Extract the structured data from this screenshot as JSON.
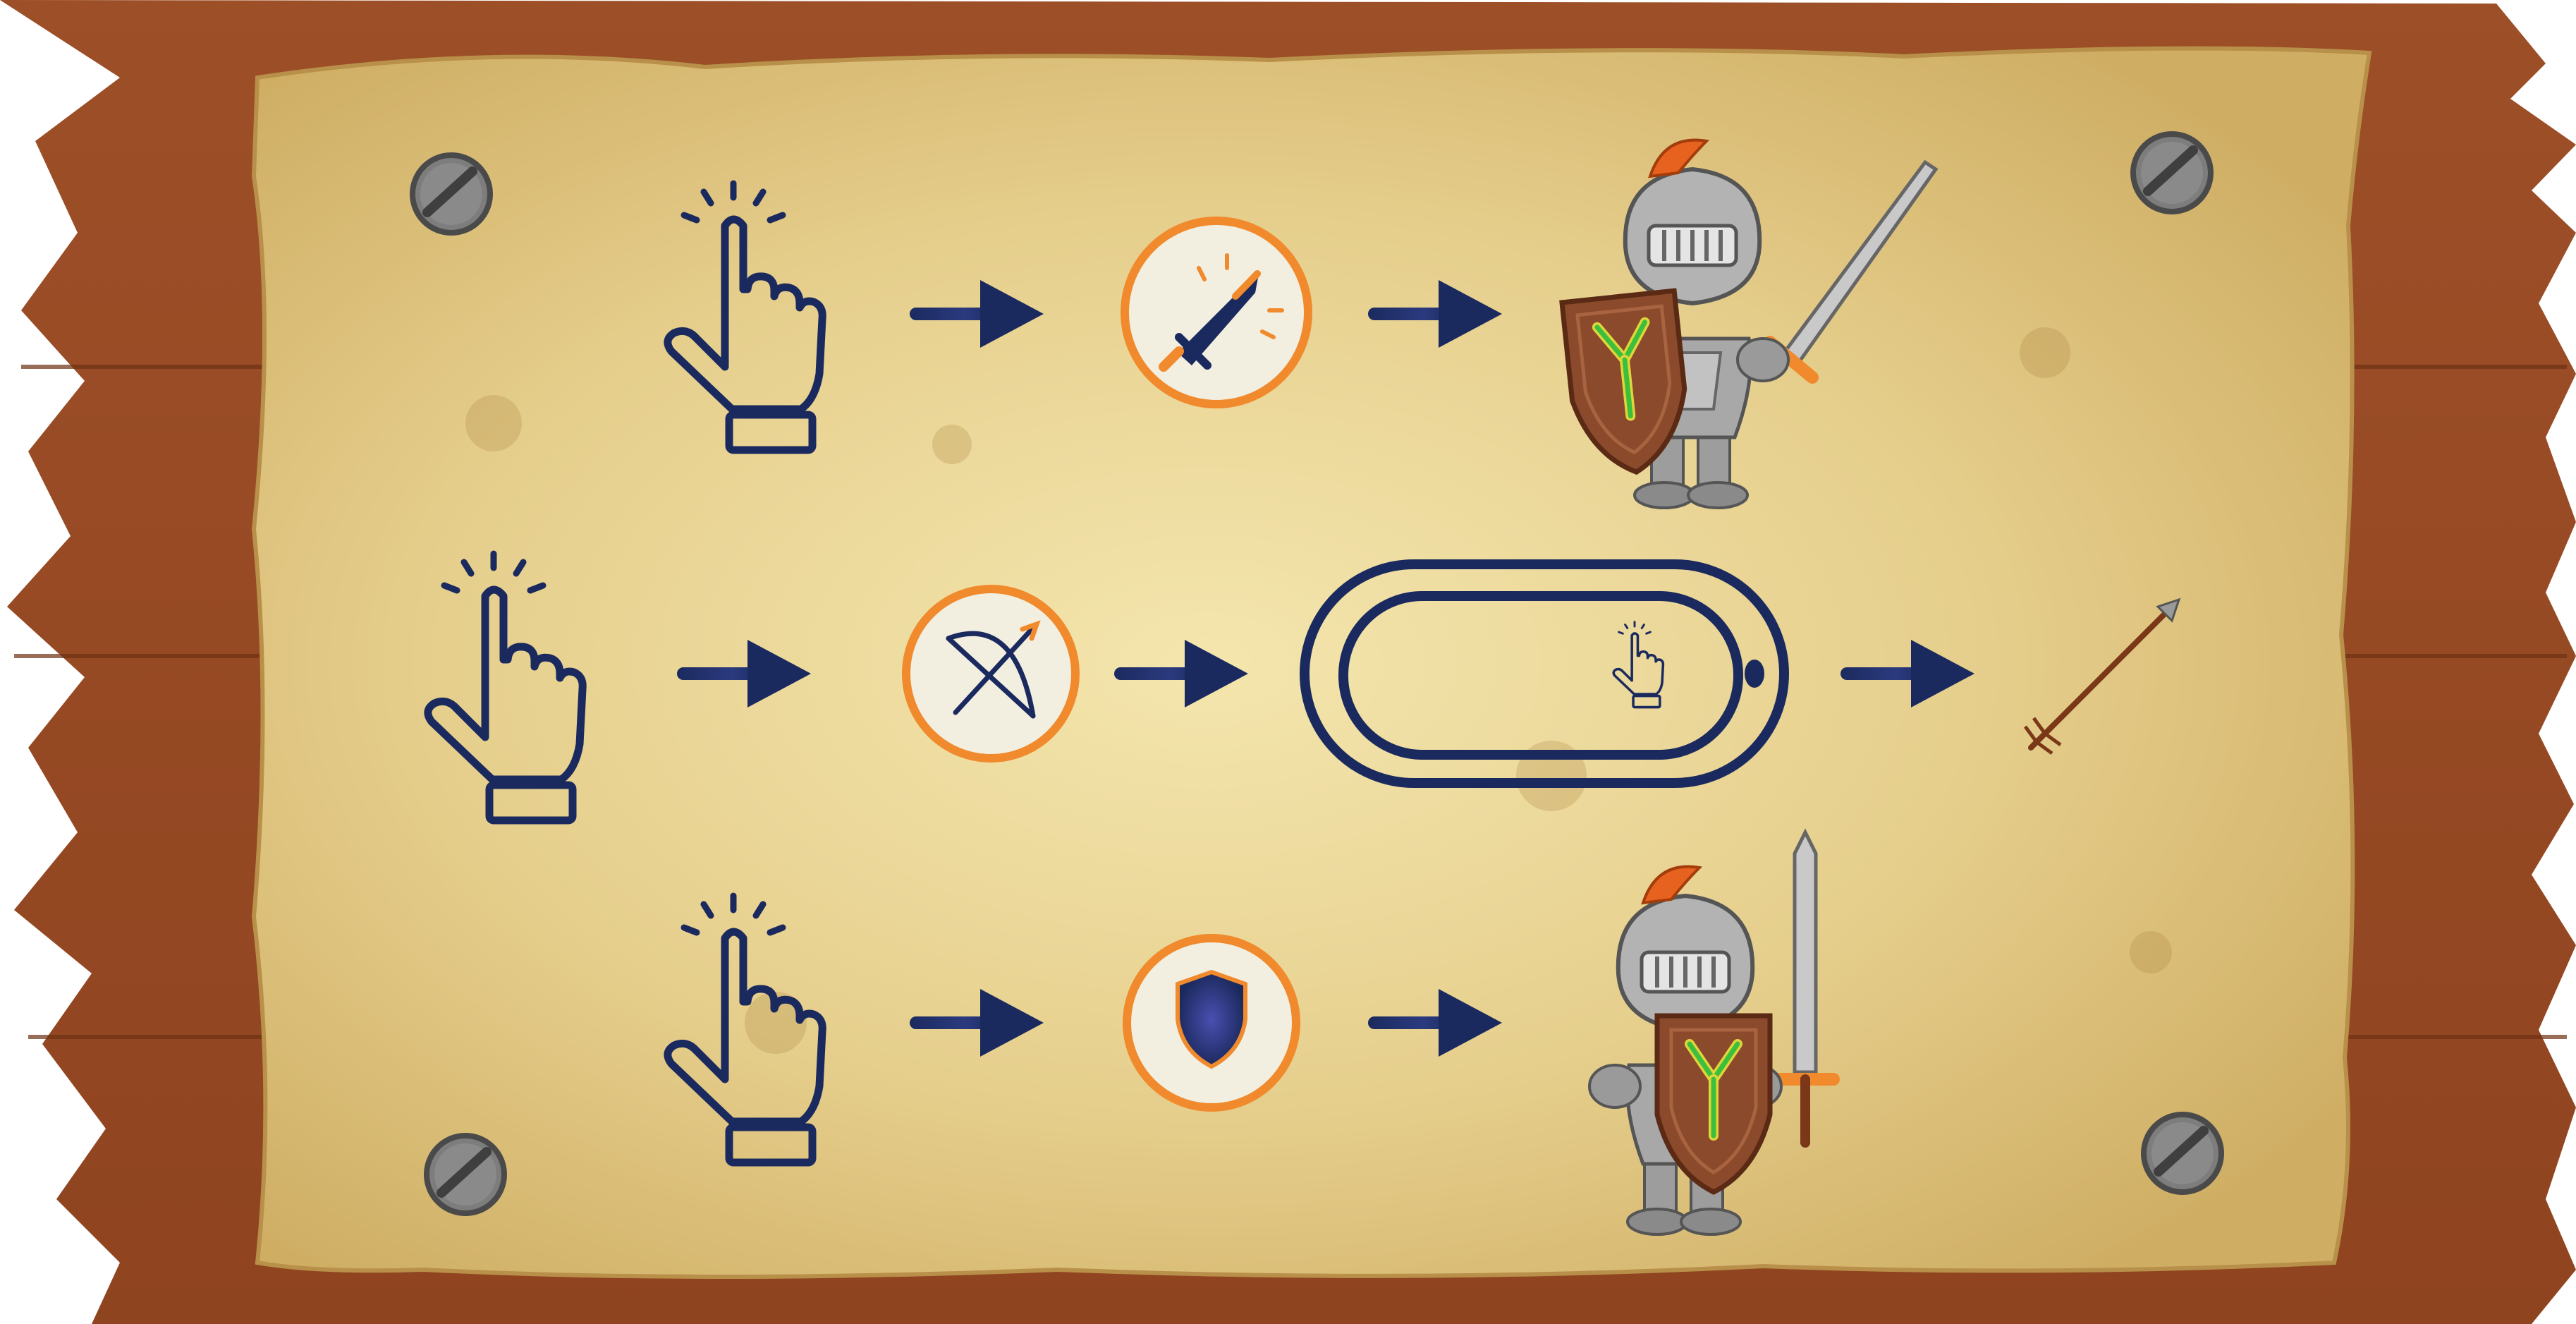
{
  "colors": {
    "wood": "#974a24",
    "wood_dark": "#7a3818",
    "parchment": "#e8d497",
    "parchment_light": "#f3e7b4",
    "parchment_dark": "#cfb067",
    "navy": "#1b2a5e",
    "orange": "#f08a2c",
    "badge_fill": "#f2eee0",
    "screw": "#808080",
    "steel": "#a6a6a6",
    "steel_dark": "#6f6f6f",
    "plume": "#e8621f",
    "shield_wood": "#8b4a2b",
    "emblem_green": "#3cbf3c",
    "emblem_yellow": "#e0d63a"
  },
  "rows": [
    {
      "action": "tap",
      "tap_icon": "tap-hand-icon",
      "ability_icon": "sword-icon",
      "result": "knight-attacking"
    },
    {
      "action": "tap",
      "tap_icon": "tap-hand-icon",
      "ability_icon": "bow-icon",
      "power_bar": "charge-bar",
      "result": "arrow"
    },
    {
      "action": "tap",
      "tap_icon": "tap-hand-icon",
      "ability_icon": "shield-icon",
      "result": "knight-defending"
    }
  ]
}
